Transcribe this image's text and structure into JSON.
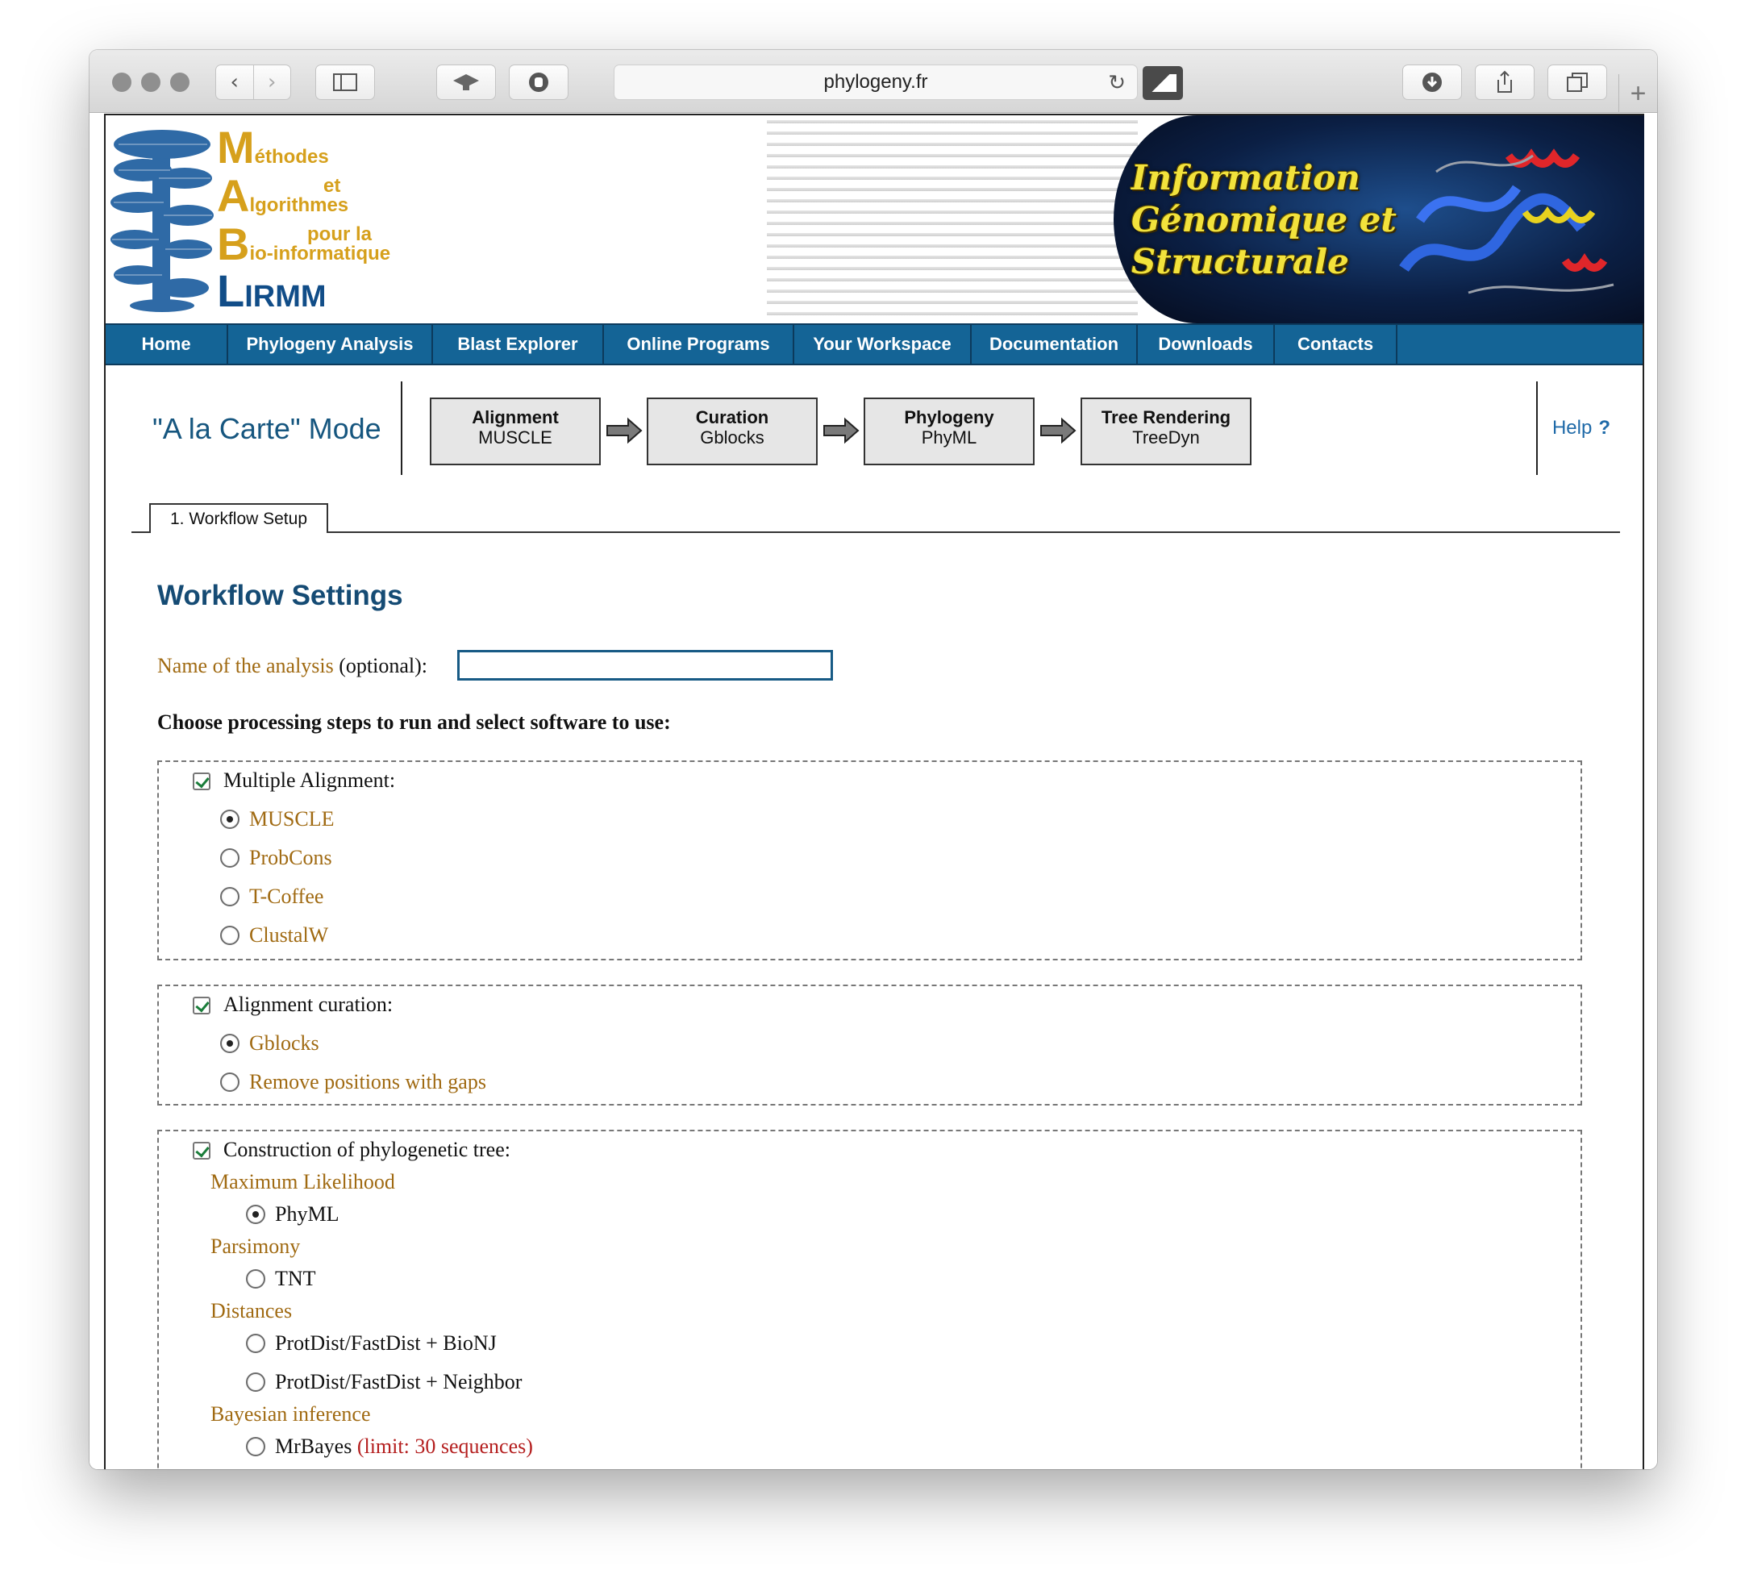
{
  "browser": {
    "url": "phylogeny.fr"
  },
  "banner": {
    "logo": {
      "line1_initial": "M",
      "line1_rest": "éthodes",
      "line2": "et",
      "line3_initial": "A",
      "line3_rest": "lgorithmes",
      "line4": "pour la",
      "line5_initial": "B",
      "line5_rest": "io-informatique",
      "line6_initial": "L",
      "line6_rest": "IRMM"
    },
    "title_lines": [
      "Information",
      "Génomique et",
      "Structurale"
    ]
  },
  "nav": {
    "items": [
      "Home",
      "Phylogeny Analysis",
      "Blast Explorer",
      "Online Programs",
      "Your Workspace",
      "Documentation",
      "Downloads",
      "Contacts"
    ]
  },
  "mode": {
    "title": "\"A la Carte\" Mode",
    "help": "Help",
    "steps": [
      {
        "title": "Alignment",
        "tool": "MUSCLE"
      },
      {
        "title": "Curation",
        "tool": "Gblocks"
      },
      {
        "title": "Phylogeny",
        "tool": "PhyML"
      },
      {
        "title": "Tree Rendering",
        "tool": "TreeDyn"
      }
    ]
  },
  "tabs": {
    "active": "1. Workflow Setup"
  },
  "form": {
    "heading": "Workflow Settings",
    "name_label": "Name of the analysis",
    "name_optional": " (optional):",
    "name_value": "",
    "choose": "Choose processing steps to run and select software to use:",
    "alignment": {
      "label": "Multiple Alignment:",
      "checked": true,
      "options": [
        "MUSCLE",
        "ProbCons",
        "T-Coffee",
        "ClustalW"
      ],
      "selected": 0
    },
    "curation": {
      "label": "Alignment curation:",
      "checked": true,
      "options": [
        "Gblocks",
        "Remove positions with gaps"
      ],
      "selected": 0
    },
    "tree": {
      "label": "Construction of phylogenetic tree:",
      "checked": true,
      "groups": [
        {
          "name": "Maximum Likelihood",
          "options": [
            "PhyML"
          ]
        },
        {
          "name": "Parsimony",
          "options": [
            "TNT"
          ]
        },
        {
          "name": "Distances",
          "options": [
            "ProtDist/FastDist + BioNJ",
            "ProtDist/FastDist + Neighbor"
          ]
        },
        {
          "name": "Bayesian inference",
          "options": [
            "MrBayes"
          ]
        }
      ],
      "mrbayes_limit": "(limit: 30 sequences)",
      "selected": "PhyML"
    }
  },
  "colors": {
    "nav_bg": "#146496",
    "heading": "#154b74",
    "option_text": "#a06a12",
    "limit_text": "#b41e1e"
  }
}
